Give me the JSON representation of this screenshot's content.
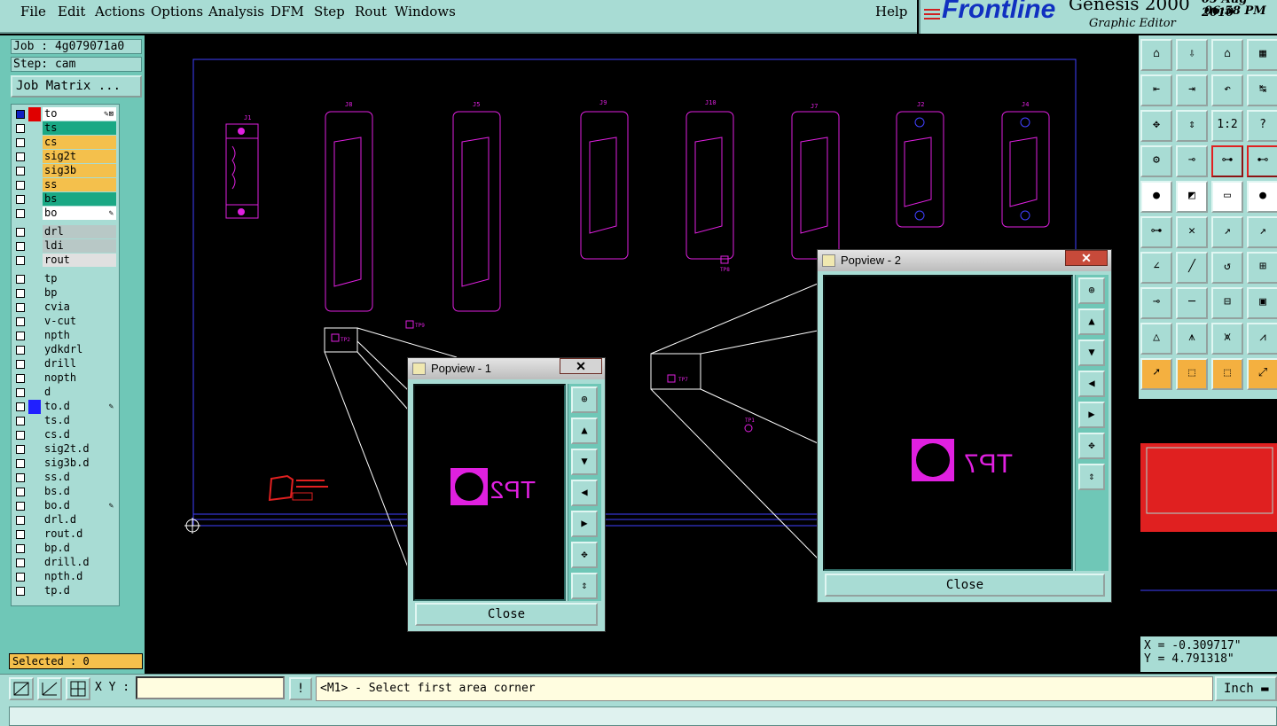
{
  "menu": {
    "items": [
      "File",
      "Edit",
      "Actions",
      "Options",
      "Analysis",
      "DFM",
      "Step",
      "Rout",
      "Windows"
    ],
    "help": "Help"
  },
  "header": {
    "logo": "Frontline",
    "app_name": "Genesis 2000",
    "subtitle": "Graphic Editor",
    "date": "05 Aug 2010",
    "time": "06:58 PM"
  },
  "job": {
    "job_label": "Job : 4g079071a0",
    "step_label": "Step: cam",
    "matrix_button": "Job Matrix ..."
  },
  "layers": [
    {
      "name": "to",
      "bg": "#ffffff",
      "color": "#e00000",
      "pen": "✎⊠",
      "checked": true
    },
    {
      "name": "ts",
      "bg": "#1aa884",
      "color": "",
      "pen": "",
      "checked": false
    },
    {
      "name": "cs",
      "bg": "#f4c04c",
      "color": "",
      "pen": "",
      "checked": false
    },
    {
      "name": "sig2t",
      "bg": "#f4c04c",
      "color": "",
      "pen": "",
      "checked": false
    },
    {
      "name": "sig3b",
      "bg": "#f4c04c",
      "color": "",
      "pen": "",
      "checked": false
    },
    {
      "name": "ss",
      "bg": "#f4c04c",
      "color": "",
      "pen": "",
      "checked": false
    },
    {
      "name": "bs",
      "bg": "#1aa884",
      "color": "",
      "pen": "",
      "checked": false
    },
    {
      "name": "bo",
      "bg": "#ffffff",
      "color": "",
      "pen": "✎",
      "checked": false
    },
    {
      "name": "drl",
      "bg": "#b8c8c6",
      "color": "",
      "pen": "",
      "checked": false
    },
    {
      "name": "ldi",
      "bg": "#b8c8c6",
      "color": "",
      "pen": "",
      "checked": false
    },
    {
      "name": "rout",
      "bg": "#e0e0e0",
      "color": "",
      "pen": "",
      "checked": false
    },
    {
      "name": "tp",
      "bg": "#a8dcd4",
      "color": "",
      "pen": "",
      "checked": false
    },
    {
      "name": "bp",
      "bg": "#a8dcd4",
      "color": "",
      "pen": "",
      "checked": false
    },
    {
      "name": "cvia",
      "bg": "#a8dcd4",
      "color": "",
      "pen": "",
      "checked": false
    },
    {
      "name": "v-cut",
      "bg": "#a8dcd4",
      "color": "",
      "pen": "",
      "checked": false
    },
    {
      "name": "npth",
      "bg": "#a8dcd4",
      "color": "",
      "pen": "",
      "checked": false
    },
    {
      "name": "ydkdrl",
      "bg": "#a8dcd4",
      "color": "",
      "pen": "",
      "checked": false
    },
    {
      "name": "drill",
      "bg": "#a8dcd4",
      "color": "",
      "pen": "",
      "checked": false
    },
    {
      "name": "nopth",
      "bg": "#a8dcd4",
      "color": "",
      "pen": "",
      "checked": false
    },
    {
      "name": "d",
      "bg": "#a8dcd4",
      "color": "",
      "pen": "",
      "checked": false
    },
    {
      "name": "to.d",
      "bg": "#a8dcd4",
      "color": "#2020ff",
      "pen": "✎",
      "checked": false
    },
    {
      "name": "ts.d",
      "bg": "#a8dcd4",
      "color": "",
      "pen": "",
      "checked": false
    },
    {
      "name": "cs.d",
      "bg": "#a8dcd4",
      "color": "",
      "pen": "",
      "checked": false
    },
    {
      "name": "sig2t.d",
      "bg": "#a8dcd4",
      "color": "",
      "pen": "",
      "checked": false
    },
    {
      "name": "sig3b.d",
      "bg": "#a8dcd4",
      "color": "",
      "pen": "",
      "checked": false
    },
    {
      "name": "ss.d",
      "bg": "#a8dcd4",
      "color": "",
      "pen": "",
      "checked": false
    },
    {
      "name": "bs.d",
      "bg": "#a8dcd4",
      "color": "",
      "pen": "",
      "checked": false
    },
    {
      "name": "bo.d",
      "bg": "#a8dcd4",
      "color": "",
      "pen": "✎",
      "checked": false
    },
    {
      "name": "drl.d",
      "bg": "#a8dcd4",
      "color": "",
      "pen": "",
      "checked": false
    },
    {
      "name": "rout.d",
      "bg": "#a8dcd4",
      "color": "",
      "pen": "",
      "checked": false
    },
    {
      "name": "bp.d",
      "bg": "#a8dcd4",
      "color": "",
      "pen": "",
      "checked": false
    },
    {
      "name": "drill.d",
      "bg": "#a8dcd4",
      "color": "",
      "pen": "",
      "checked": false
    },
    {
      "name": "npth.d",
      "bg": "#a8dcd4",
      "color": "",
      "pen": "",
      "checked": false
    },
    {
      "name": "tp.d",
      "bg": "#a8dcd4",
      "color": "",
      "pen": "",
      "checked": false
    }
  ],
  "selected_label": "Selected : 0",
  "canvas": {
    "connectors": [
      "J1",
      "J8",
      "J5",
      "J9",
      "J10",
      "J7",
      "J2",
      "J4"
    ],
    "test_points": [
      "TP1",
      "TP2",
      "TP7",
      "TP8",
      "TP9"
    ]
  },
  "popview1": {
    "title": "Popview - 1",
    "label": "TP2",
    "close": "Close"
  },
  "popview2": {
    "title": "Popview - 2",
    "label": "TP7",
    "close": "Close"
  },
  "coords": {
    "x": "X = -0.309717\"",
    "y": "Y = 4.791318\""
  },
  "bottom": {
    "xy_label": "X Y :",
    "xy_value": "",
    "exclaim": "!",
    "prompt": "<M1> - Select first area corner",
    "units": "Inch"
  },
  "tool_icons": [
    "home-icon",
    "pan-icon",
    "zoom-icon",
    "measure-icon"
  ],
  "colors": {
    "panel": "#a8dcd4",
    "accent": "#6fc7b7",
    "magenta": "#e020e0",
    "board_outline": "#4040ff"
  }
}
